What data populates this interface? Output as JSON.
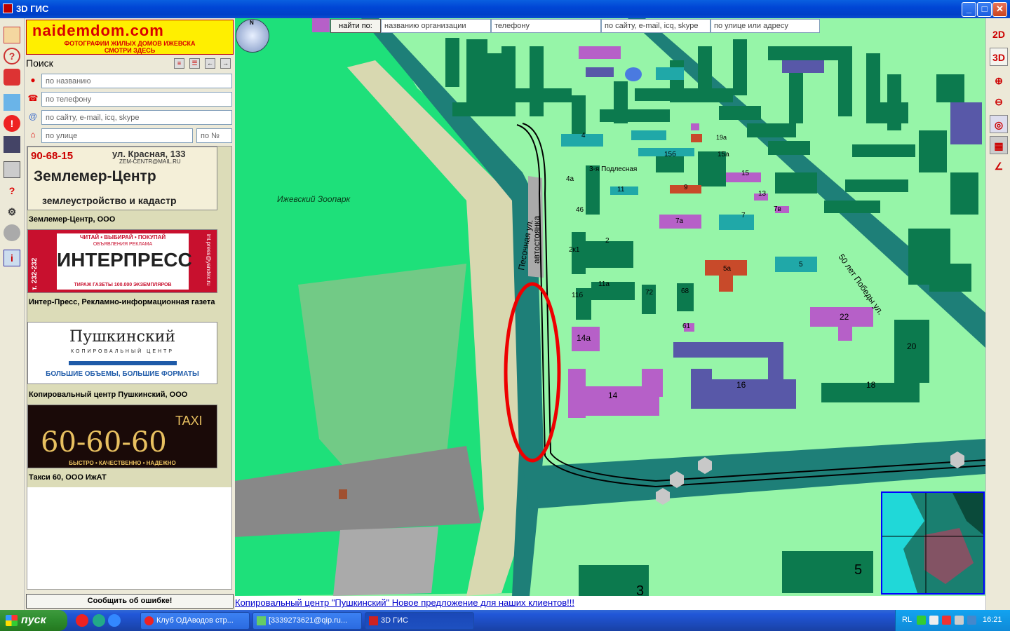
{
  "window": {
    "title": "3D ГИС",
    "minimize": "_",
    "maximize": "□",
    "close": "✕"
  },
  "sidebar": {
    "banner": {
      "site": "naidemdom.com",
      "line1": "ФОТОГРАФИИ ЖИЛЫХ ДОМОВ ИЖЕВСКА",
      "line2": "СМОТРИ ЗДЕСЬ"
    },
    "search_title": "Поиск",
    "fields": {
      "name_placeholder": "по названию",
      "phone_placeholder": "по телефону",
      "site_placeholder": "по сайту, e-mail, icq, skype",
      "street_placeholder": "по улице",
      "house_placeholder": "по №"
    },
    "ads": [
      {
        "caption": "Землемер-Центр, ООО",
        "phone": "90-68-15",
        "street": "ул. Красная, 133",
        "email": "ZEM-CENTR@MAIL.RU",
        "title": "Землемер-Центр",
        "subtitle": "землеустройство и кадастр"
      },
      {
        "caption": "Интер-Пресс, Рекламно-информационная газета",
        "top": "ЧИТАЙ • ВЫБИРАЙ • ПОКУПАЙ",
        "sub": "ОБЪЯВЛЕНИЯ РЕКЛАМА",
        "title": "ИНТЕРПРЕСС",
        "bottom": "ТИРАЖ ГАЗЕТЫ 100.000 ЭКЗЕМПЛЯРОВ",
        "phone": "т. 232-232",
        "email": "int.press@yandex.ru"
      },
      {
        "caption": "Копировальный центр Пушкинский, ООО",
        "title": "Пушкинский",
        "sub": "КОПИРОВАЛЬНЫЙ ЦЕНТР",
        "slogan": "БОЛЬШИЕ ОБЪЕМЫ, БОЛЬШИЕ ФОРМАТЫ"
      },
      {
        "caption": "Такси 60, ООО ИжАТ",
        "taxi": "TAXI",
        "number": "60-60-60",
        "slogan": "БЫСТРО • КАЧЕСТВЕННО • НАДЕЖНО"
      }
    ],
    "error_button": "Сообщить об ошибке!"
  },
  "findbar": {
    "button": "найти по:",
    "org_placeholder": "названию организации",
    "phone_placeholder": "телефону",
    "site_placeholder": "по сайту, e-mail, icq, skype",
    "address_placeholder": "по улице или адресу"
  },
  "map": {
    "labels": {
      "zoo": "Ижевский Зоопарк",
      "parking": "автостоянка",
      "sand_street": "Песочная ул.",
      "podlesnaya": "3-я Подлесная",
      "victory": "50 лет Победы ул."
    },
    "buildings": [
      "14",
      "16",
      "18",
      "22",
      "20",
      "14а",
      "61",
      "68",
      "72",
      "11б",
      "11а",
      "2к1",
      "2",
      "46",
      "4а",
      "4",
      "11",
      "9",
      "7а",
      "7",
      "7в",
      "5а",
      "5",
      "13",
      "15",
      "15б",
      "15а",
      "19а",
      "5",
      "3"
    ]
  },
  "right_toolbar": {
    "mode_2d": "2D",
    "mode_3d": "3D"
  },
  "bottom_link": "Копировальный центр \"Пушкинский\" Новое предложение для наших клиентов!!!",
  "taskbar": {
    "start": "пуск",
    "tasks": [
      "Клуб ОДАводов стр...",
      "[3339273621@qip.ru...",
      "3D ГИС"
    ],
    "lang": "RL",
    "clock": "16:21"
  },
  "colors": {
    "map_green": "#96f5a8",
    "road": "#1e7f78",
    "building": "#0c7a4e",
    "purple": "#b660c8",
    "zoo": "#1ee07a"
  }
}
